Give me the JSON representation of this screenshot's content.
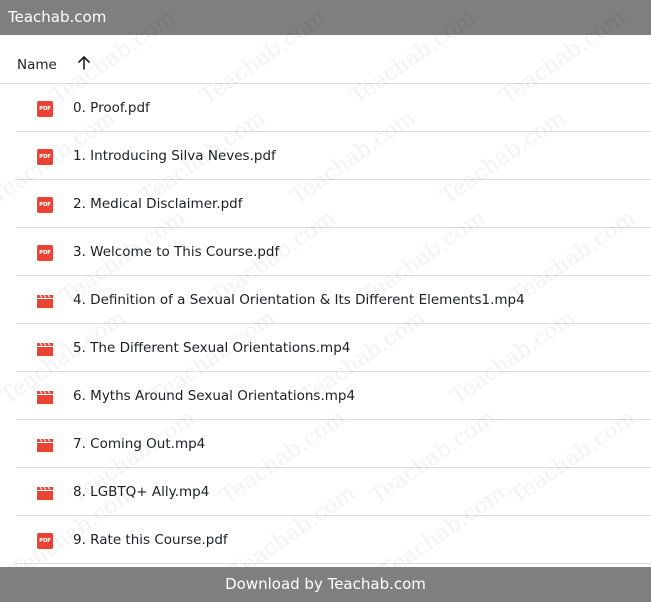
{
  "topbar": {
    "title": "Teachab.com"
  },
  "list": {
    "header": {
      "name_label": "Name",
      "sort_icon": "arrow-up-icon"
    },
    "files": [
      {
        "name": "0. Proof.pdf",
        "type": "pdf",
        "icon_label": "PDF"
      },
      {
        "name": "1. Introducing Silva Neves.pdf",
        "type": "pdf",
        "icon_label": "PDF"
      },
      {
        "name": "2. Medical Disclaimer.pdf",
        "type": "pdf",
        "icon_label": "PDF"
      },
      {
        "name": "3. Welcome to This Course.pdf",
        "type": "pdf",
        "icon_label": "PDF"
      },
      {
        "name": "4. Definition of a Sexual Orientation & Its Different Elements1.mp4",
        "type": "video"
      },
      {
        "name": "5. The Different Sexual Orientations.mp4",
        "type": "video"
      },
      {
        "name": "6. Myths Around Sexual Orientations.mp4",
        "type": "video"
      },
      {
        "name": "7. Coming Out.mp4",
        "type": "video"
      },
      {
        "name": "8. LGBTQ+ Ally.mp4",
        "type": "video"
      },
      {
        "name": "9. Rate this Course.pdf",
        "type": "pdf",
        "icon_label": "PDF"
      }
    ]
  },
  "footer": {
    "text": "Download by Teachab.com"
  },
  "watermark": {
    "text": "Teachab.com"
  },
  "colors": {
    "bar": "#7f7f7f",
    "file_icon": "#ea4335",
    "divider": "#dadce0",
    "text": "#202124"
  }
}
